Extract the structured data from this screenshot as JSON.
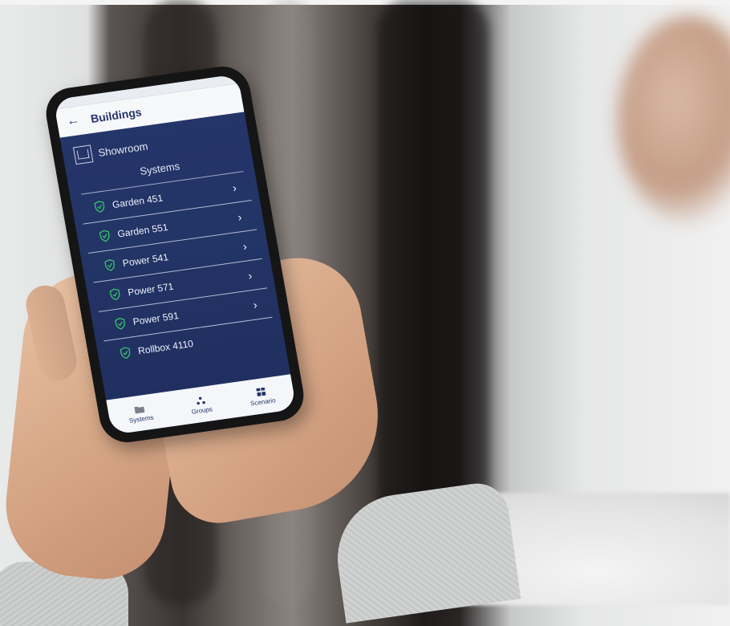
{
  "app": {
    "header": {
      "back_icon": "back-arrow-icon",
      "title": "Buildings"
    },
    "building": {
      "icon": "building-icon",
      "name": "Showroom"
    },
    "section_label": "Systems",
    "systems": [
      {
        "name": "Garden 451",
        "status_icon": "shield-check-icon"
      },
      {
        "name": "Garden 551",
        "status_icon": "shield-check-icon"
      },
      {
        "name": "Power 541",
        "status_icon": "shield-check-icon"
      },
      {
        "name": "Power 571",
        "status_icon": "shield-check-icon"
      },
      {
        "name": "Power 591",
        "status_icon": "shield-check-icon"
      },
      {
        "name": "Rollbox 4110",
        "status_icon": "shield-check-icon"
      }
    ],
    "bottom_nav": [
      {
        "label": "Systems",
        "icon": "folder-icon"
      },
      {
        "label": "Groups",
        "icon": "groups-icon"
      },
      {
        "label": "Scenario",
        "icon": "scenario-icon"
      }
    ],
    "colors": {
      "primary": "#24356a",
      "accent_green": "#37c26a",
      "surface": "#f7f8fa"
    }
  }
}
